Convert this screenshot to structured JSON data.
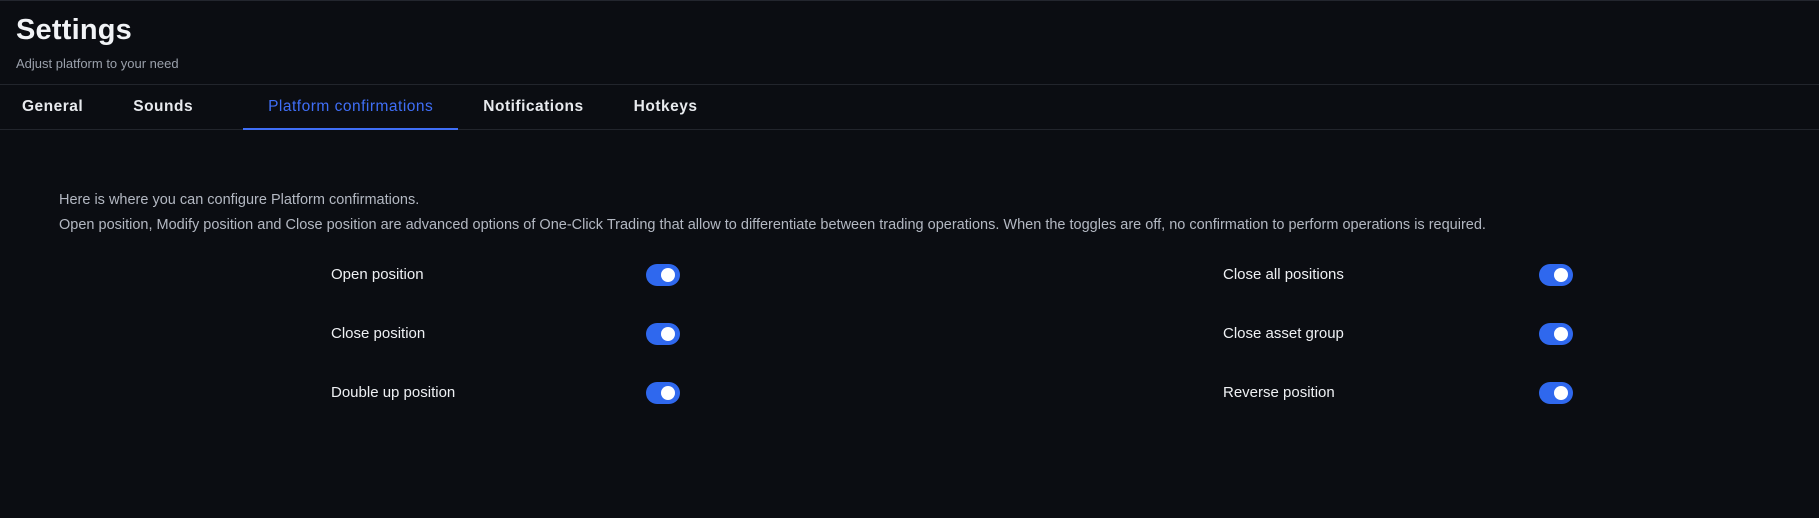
{
  "header": {
    "title": "Settings",
    "subtitle": "Adjust platform to your need"
  },
  "tabs": [
    {
      "label": "General",
      "active": false
    },
    {
      "label": "Sounds",
      "active": false
    },
    {
      "label": "Platform confirmations",
      "active": true
    },
    {
      "label": "Notifications",
      "active": false
    },
    {
      "label": "Hotkeys",
      "active": false
    }
  ],
  "description": {
    "line1": "Here is where you can configure Platform confirmations.",
    "line2": "Open position, Modify position and Close position are advanced options of One-Click Trading that allow to differentiate between trading operations. When the toggles are off, no confirmation to perform operations is required."
  },
  "options": {
    "left": [
      {
        "label": "Open position",
        "enabled": true
      },
      {
        "label": "Close position",
        "enabled": true
      },
      {
        "label": "Double up position",
        "enabled": true
      }
    ],
    "right": [
      {
        "label": "Close all positions",
        "enabled": true
      },
      {
        "label": "Close asset group",
        "enabled": true
      },
      {
        "label": "Reverse position",
        "enabled": true
      }
    ]
  },
  "colors": {
    "background": "#0b0d12",
    "accent": "#3f6ef6",
    "toggle_on": "#2f68ee"
  }
}
